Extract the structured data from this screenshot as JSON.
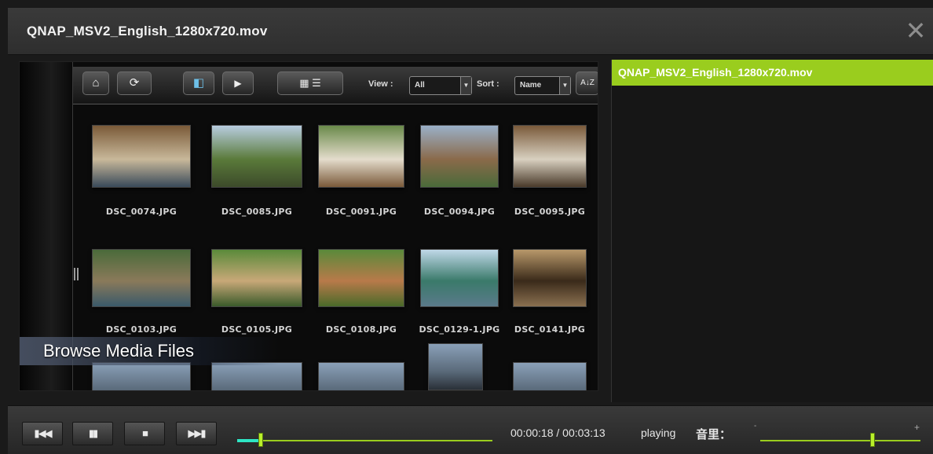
{
  "window": {
    "title": "QNAP_MSV2_English_1280x720.mov",
    "close_glyph": "✕"
  },
  "video_frame": {
    "toolbar": {
      "view_label": "View :",
      "view_value": "All",
      "sort_label": "Sort :",
      "sort_value": "Name",
      "sort_az": "A↓Z"
    },
    "thumbnails": [
      {
        "name": "DSC_0074.JPG",
        "colors": [
          "#7a5a38",
          "#c8b89a",
          "#3a4a5a"
        ]
      },
      {
        "name": "DSC_0085.JPG",
        "colors": [
          "#b8cde0",
          "#5a7a3a",
          "#3c4a2a"
        ]
      },
      {
        "name": "DSC_0091.JPG",
        "colors": [
          "#6a8a4a",
          "#e4dccc",
          "#7a5a3a"
        ]
      },
      {
        "name": "DSC_0094.JPG",
        "colors": [
          "#9ab0c8",
          "#8a6a4a",
          "#4a6a3a"
        ]
      },
      {
        "name": "DSC_0095.JPG",
        "colors": [
          "#7a5a3a",
          "#d8d0c0",
          "#4a3a2a"
        ]
      },
      {
        "name": "DSC_0103.JPG",
        "colors": [
          "#4a6a3a",
          "#8a7a5a",
          "#3a5a6a"
        ]
      },
      {
        "name": "DSC_0105.JPG",
        "colors": [
          "#5a8a3a",
          "#c8a878",
          "#3a5a2a"
        ]
      },
      {
        "name": "DSC_0108.JPG",
        "colors": [
          "#5a8a3a",
          "#b87a4a",
          "#4a6a2a"
        ]
      },
      {
        "name": "DSC_0129-1.JPG",
        "colors": [
          "#c0d8e8",
          "#3a7a6a",
          "#5a7a8a"
        ]
      },
      {
        "name": "DSC_0141.JPG",
        "colors": [
          "#b8986a",
          "#3a2a1a",
          "#8a7050"
        ]
      }
    ],
    "caption": "Browse Media Files"
  },
  "playlist": {
    "items": [
      "QNAP_MSV2_English_1280x720.mov"
    ]
  },
  "controls": {
    "prev_glyph": "▮◀◀",
    "pause_glyph": "▮▮",
    "stop_glyph": "■",
    "next_glyph": "▶▶▮",
    "time": "00:00:18 / 00:03:13",
    "status": "playing",
    "volume_label": "音里：",
    "volume_minus": "-",
    "volume_plus": "+",
    "progress_fraction": 0.093,
    "volume_fraction": 0.7
  },
  "colors": {
    "accent": "#9acd1e",
    "seek_played": "#2ee6c4"
  }
}
